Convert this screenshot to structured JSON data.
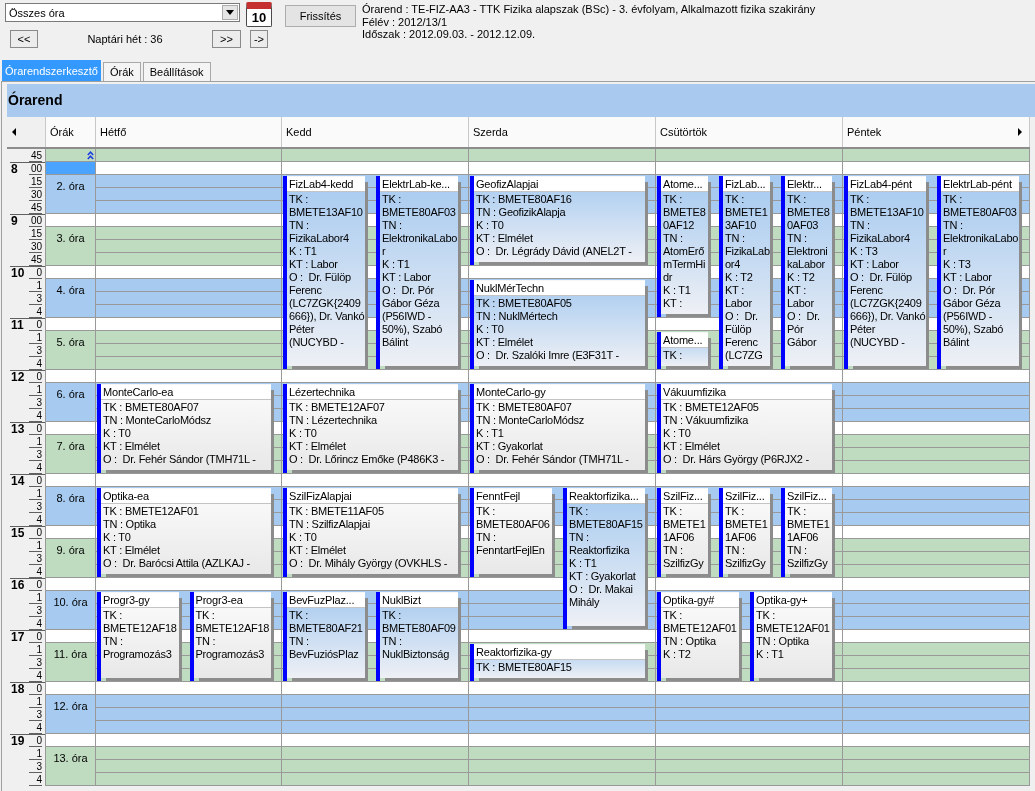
{
  "toolbar": {
    "filter": {
      "value": "Összes óra"
    },
    "calendar_button": "10",
    "refresh_button": "Frissítés",
    "prev_button": "<<",
    "week_label": "Naptári hét : 36",
    "next_button": ">>",
    "jump_button": "->"
  },
  "info": [
    "Órarend : TE-FIZ-AA3 - TTK Fizika alapszak (BSc) - 3. évfolyam, Alkalmazott fizika szakirány",
    "Félév : 2012/13/1",
    "Időszak : 2012.09.03. - 2012.12.09."
  ],
  "tabs": [
    {
      "label": "Órarendszerkesztő",
      "selected": true
    },
    {
      "label": "Órák",
      "selected": false
    },
    {
      "label": "Beállítások",
      "selected": false
    }
  ],
  "panel": {
    "title": "Órarend"
  },
  "grid": {
    "periods_header": "Órák",
    "lead": {
      "minute": "45",
      "color": "#c0dcc0"
    },
    "hours": [
      {
        "hour": "8",
        "minutes": [
          "00",
          "15",
          "30",
          "45"
        ],
        "selected": true,
        "period": {
          "label": "2. óra",
          "color": "#a6caf0"
        }
      },
      {
        "hour": "9",
        "minutes": [
          "00",
          "15",
          "30",
          "45"
        ],
        "selected": false,
        "period": {
          "label": "3. óra",
          "color": "#c0dcc0"
        }
      },
      {
        "hour": "10",
        "minutes": [
          "0",
          "1",
          "3",
          "4"
        ],
        "selected": false,
        "period": {
          "label": "4. óra",
          "color": "#a6caf0"
        }
      },
      {
        "hour": "11",
        "minutes": [
          "0",
          "1",
          "3",
          "4"
        ],
        "selected": false,
        "period": {
          "label": "5. óra",
          "color": "#c0dcc0"
        }
      },
      {
        "hour": "12",
        "minutes": [
          "0",
          "1",
          "3",
          "4"
        ],
        "selected": false,
        "period": {
          "label": "6. óra",
          "color": "#a6caf0"
        }
      },
      {
        "hour": "13",
        "minutes": [
          "0",
          "1",
          "3",
          "4"
        ],
        "selected": false,
        "period": {
          "label": "7. óra",
          "color": "#c0dcc0"
        }
      },
      {
        "hour": "14",
        "minutes": [
          "0",
          "1",
          "3",
          "4"
        ],
        "selected": false,
        "period": {
          "label": "8. óra",
          "color": "#a6caf0"
        }
      },
      {
        "hour": "15",
        "minutes": [
          "0",
          "1",
          "3",
          "4"
        ],
        "selected": false,
        "period": {
          "label": "9. óra",
          "color": "#c0dcc0"
        }
      },
      {
        "hour": "16",
        "minutes": [
          "0",
          "1",
          "3",
          "4"
        ],
        "selected": false,
        "period": {
          "label": "10. óra",
          "color": "#a6caf0"
        }
      },
      {
        "hour": "17",
        "minutes": [
          "0",
          "1",
          "3",
          "4"
        ],
        "selected": false,
        "period": {
          "label": "11. óra",
          "color": "#c0dcc0"
        }
      },
      {
        "hour": "18",
        "minutes": [
          "0",
          "1",
          "3",
          "4"
        ],
        "selected": false,
        "period": {
          "label": "12. óra",
          "color": "#a6caf0"
        }
      },
      {
        "hour": "19",
        "minutes": [
          "0",
          "1",
          "3",
          "4"
        ],
        "selected": false,
        "period": {
          "label": "13. óra",
          "color": "#c0dcc0"
        }
      }
    ],
    "days": [
      {
        "name": "Hétfő",
        "events": [
          {
            "title": "MonteCarlo-ea",
            "highlighted": false,
            "details": [
              "TK : BMETE80AF07",
              "TN : MonteCarloMódsz",
              "K : T0",
              "KT : Elmélet",
              "O :  Dr. Fehér Sándor (TMH71L -"
            ]
          },
          {
            "title": "Optika-ea",
            "highlighted": false,
            "details": [
              "TK : BMETE12AF01",
              "TN : Optika",
              "K : T0",
              "KT : Elmélet",
              "O :  Dr. Barócsi Attila (AZLKAJ -"
            ]
          },
          {
            "title": "Progr3-gy",
            "highlighted": false,
            "details": [
              "TK : BMETE12AF18",
              "TN : Programozás3"
            ]
          },
          {
            "title": "Progr3-ea",
            "highlighted": false,
            "details": [
              "TK : BMETE12AF18",
              "TN : Programozás3"
            ]
          }
        ]
      },
      {
        "name": "Kedd",
        "events": [
          {
            "title": "FizLab4-kedd",
            "highlighted": true,
            "details": [
              "TK : BMETE13AF10",
              "TN : FizikaLabor4",
              "K : T1",
              "KT : Labor",
              "O :  Dr. Fülöp Ferenc (LC7ZGK{2409666}), Dr. Vankó Péter (NUCYBD -"
            ]
          },
          {
            "title": "ElektrLab-ke...",
            "highlighted": true,
            "details": [
              "TK : BMETE80AF03",
              "TN : ElektronikaLabor",
              "K : T1",
              "KT : Labor",
              "O :  Dr. Pór Gábor Géza (P56IWD - 50%), Szabó Bálint"
            ]
          },
          {
            "title": "Lézertechnika",
            "highlighted": false,
            "details": [
              "TK : BMETE12AF07",
              "TN : Lézertechnika",
              "K : T0",
              "KT : Elmélet",
              "O :  Dr. Lőrincz Emőke (P486K3 -"
            ]
          },
          {
            "title": "SzilFizAlapjai",
            "highlighted": false,
            "details": [
              "TK : BMETE11AF05",
              "TN : SzilfizAlapjai",
              "K : T0",
              "KT : Elmélet",
              "O :  Dr. Mihály György (OVKHLS -"
            ]
          },
          {
            "title": "BevFuzPlaz...",
            "highlighted": true,
            "details": [
              "TK : BMETE80AF21",
              "TN : BevFuziósPlaz"
            ]
          },
          {
            "title": "NuklBizt",
            "highlighted": true,
            "details": [
              "TK : BMETE80AF09",
              "TN : NuklBiztonság"
            ]
          }
        ]
      },
      {
        "name": "Szerda",
        "events": [
          {
            "title": "GeofizAlapjai",
            "highlighted": true,
            "details": [
              "TK : BMETE80AF16",
              "TN : GeofizikAlapja",
              "K : T0",
              "KT : Elmélet",
              "O :  Dr. Légrády Dávid (ANEL2T -"
            ]
          },
          {
            "title": "NuklMérTechn",
            "highlighted": true,
            "details": [
              "TK : BMETE80AF05",
              "TN : NuklMértech",
              "K : T0",
              "KT : Elmélet",
              "O :  Dr. Szalóki Imre (E3F31T -"
            ]
          },
          {
            "title": "MonteCarlo-gy",
            "highlighted": false,
            "details": [
              "TK : BMETE80AF07",
              "TN : MonteCarloMódsz",
              "K : T1",
              "KT : Gyakorlat",
              "O :  Dr. Fehér Sándor (TMH71L -"
            ]
          },
          {
            "title": "FenntFejl",
            "highlighted": false,
            "details": [
              "TK : BMETE80AF06",
              "TN : FenntartFejlEn"
            ]
          },
          {
            "title": "Reaktorfizika...",
            "highlighted": true,
            "details": [
              "TK : BMETE80AF15",
              "TN : Reaktorfizika",
              "K : T1",
              "KT : Gyakorlat",
              "O :  Dr. Makai Mihály"
            ]
          },
          {
            "title": "Reaktorfizika-gy",
            "highlighted": true,
            "details": [
              "TK : BMETE80AF15"
            ]
          }
        ]
      },
      {
        "name": "Csütörtök",
        "events": [
          {
            "title": "Atome...",
            "highlighted": true,
            "details": [
              "TK : BMETE80AF12",
              "TN : AtomErőmTermHidr",
              "K : T1",
              "KT :"
            ]
          },
          {
            "title": "FizLab...",
            "highlighted": true,
            "details": [
              "TK : BMETE13AF10",
              "TN : FizikaLabor4",
              "K : T2",
              "KT : Labor",
              "O :  Dr. Fülöp Ferenc (LC7ZG"
            ]
          },
          {
            "title": "Elektr...",
            "highlighted": true,
            "details": [
              "TK : BMETE80AF03",
              "TN : ElektronikaLabor",
              "K : T2",
              "KT : Labor",
              "O :  Dr. Pór Gábor"
            ]
          },
          {
            "title": "Atome...",
            "highlighted": true,
            "details": [
              "TK :"
            ]
          },
          {
            "title": "Vákuumfizika",
            "highlighted": false,
            "details": [
              "TK : BMETE12AF05",
              "TN : Vákuumfizika",
              "K : T0",
              "KT : Elmélet",
              "O :  Dr. Hárs György (P6RJX2 -"
            ]
          },
          {
            "title": "SzilFiz...",
            "highlighted": false,
            "details": [
              "TK : BMETE11AF06",
              "TN : SzilfizGy"
            ]
          },
          {
            "title": "SzilFiz...",
            "highlighted": false,
            "details": [
              "TK : BMETE11AF06",
              "TN : SzilfizGy"
            ]
          },
          {
            "title": "SzilFiz...",
            "highlighted": false,
            "details": [
              "TK : BMETE11AF06",
              "TN : SzilfizGy"
            ]
          },
          {
            "title": "Optika-gy#",
            "highlighted": false,
            "details": [
              "TK : BMETE12AF01",
              "TN : Optika",
              "K : T2"
            ]
          },
          {
            "title": "Optika-gy+",
            "highlighted": false,
            "details": [
              "TK : BMETE12AF01",
              "TN : Optika",
              "K : T1"
            ]
          }
        ]
      },
      {
        "name": "Péntek",
        "events": [
          {
            "title": "FizLab4-pént",
            "highlighted": true,
            "details": [
              "TK : BMETE13AF10",
              "TN : FizikaLabor4",
              "K : T3",
              "KT : Labor",
              "O :  Dr. Fülöp Ferenc (LC7ZGK{2409666}), Dr. Vankó Péter (NUCYBD -"
            ]
          },
          {
            "title": "ElektrLab-pént",
            "highlighted": true,
            "details": [
              "TK : BMETE80AF03",
              "TN : ElektronikaLabor",
              "K : T3",
              "KT : Labor",
              "O :  Dr. Pór Gábor Géza (P56IWD - 50%), Szabó Bálint"
            ]
          }
        ]
      }
    ]
  }
}
